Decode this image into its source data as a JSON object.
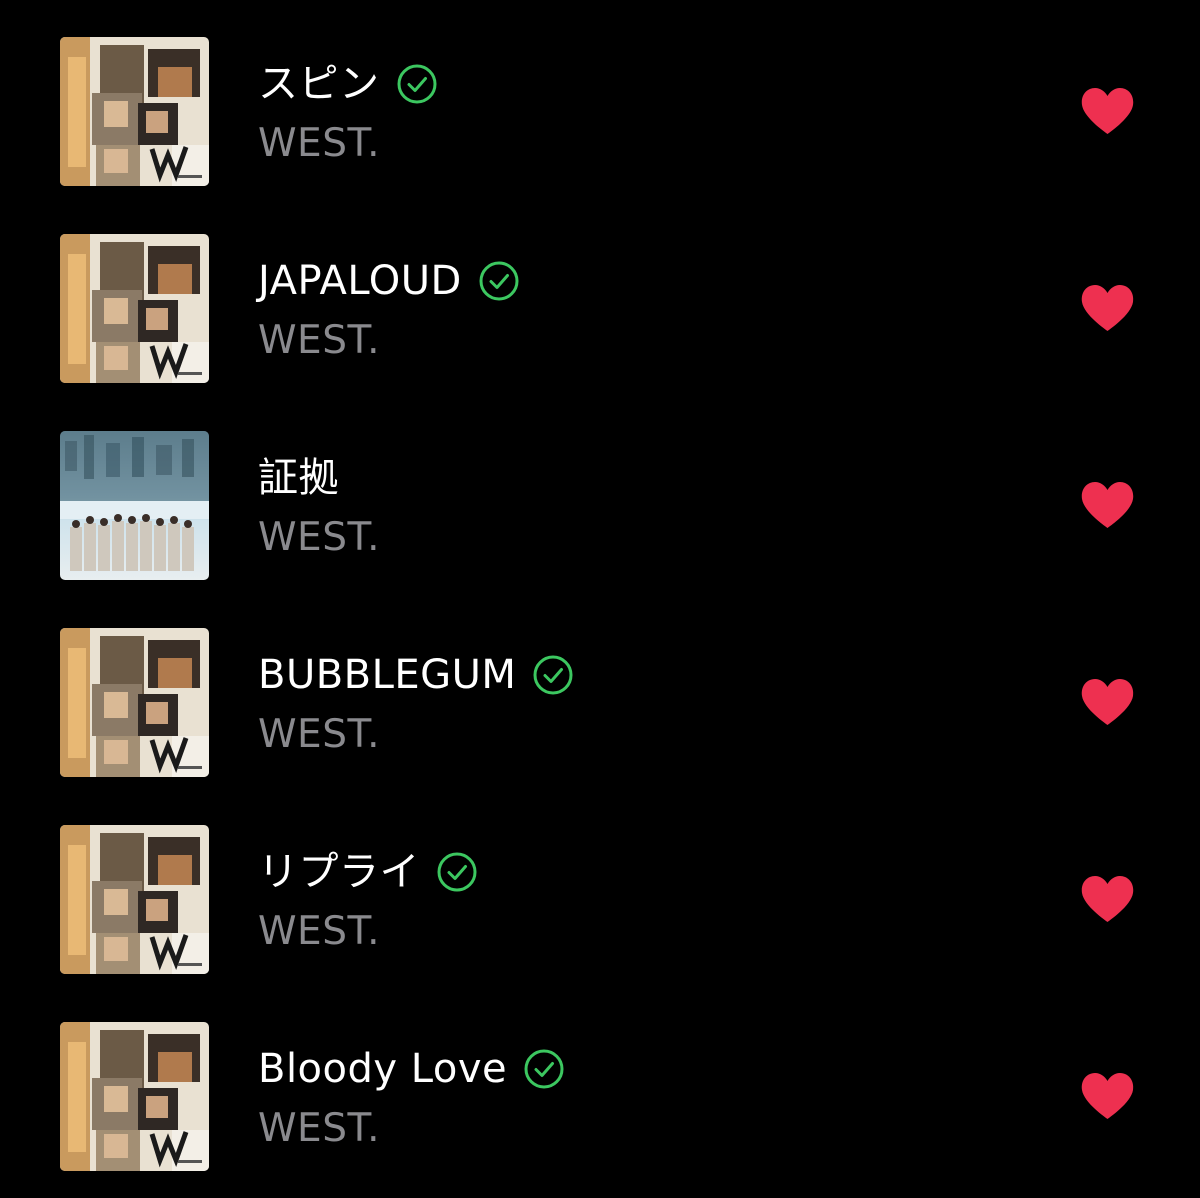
{
  "colors": {
    "background": "#000000",
    "title": "#ffffff",
    "artist": "#8a8a8e",
    "verified_check": "#3cc760",
    "heart": "#ee3050"
  },
  "songs": [
    {
      "title": "スピン",
      "artist": "WEST.",
      "verified": true,
      "favorited": true,
      "artwork": "album-cover-group-collage-icon"
    },
    {
      "title": "JAPALOUD",
      "artist": "WEST.",
      "verified": true,
      "favorited": true,
      "artwork": "album-cover-group-collage-icon"
    },
    {
      "title": "証拠",
      "artist": "WEST.",
      "verified": false,
      "favorited": true,
      "artwork": "album-cover-city-sky-group-icon"
    },
    {
      "title": "BUBBLEGUM",
      "artist": "WEST.",
      "verified": true,
      "favorited": true,
      "artwork": "album-cover-group-collage-icon"
    },
    {
      "title": "リプライ",
      "artist": "WEST.",
      "verified": true,
      "favorited": true,
      "artwork": "album-cover-group-collage-icon"
    },
    {
      "title": "Bloody Love",
      "artist": "WEST.",
      "verified": true,
      "favorited": true,
      "artwork": "album-cover-group-collage-icon"
    }
  ],
  "icons": {
    "verified": "check-circle-icon",
    "favorite": "heart-icon"
  }
}
